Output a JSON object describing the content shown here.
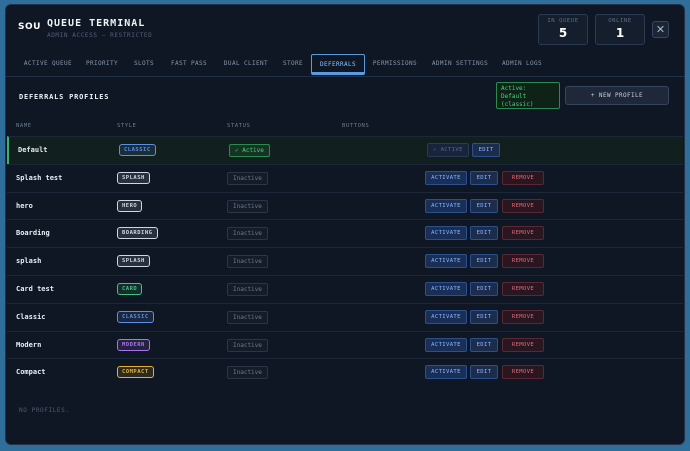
{
  "app": {
    "logo": "SOU",
    "title": "QUEUE TERMINAL",
    "subtitle": "ADMIN ACCESS — RESTRICTED",
    "close_label": "✕"
  },
  "stats": {
    "in_queue_label": "IN QUEUE",
    "in_queue_value": "5",
    "online_label": "ONLINE",
    "online_value": "1"
  },
  "tabs": [
    "ACTIVE QUEUE",
    "PRIORITY",
    "SLOTS",
    "FAST PASS",
    "DUAL CLIENT",
    "STORE",
    "DEFERRALS",
    "PERMISSIONS",
    "ADMIN SETTINGS",
    "ADMIN LOGS"
  ],
  "active_tab": "DEFERRALS",
  "section": {
    "title": "DEFERRALS PROFILES",
    "active_line1": "Active:",
    "active_line2": "Default",
    "active_line3": "(classic)",
    "new_profile": "+ NEW PROFILE"
  },
  "columns": {
    "name": "NAME",
    "style": "STYLE",
    "status": "STATUS",
    "buttons": "BUTTONS"
  },
  "actions": {
    "activate": "ACTIVATE",
    "active": "✓ ACTIVE",
    "edit": "EDIT",
    "remove": "REMOVE"
  },
  "status_text": {
    "active": "✓ Active",
    "inactive": "Inactive"
  },
  "style_colors": {
    "classic": "#5a8fe8",
    "splash": "#cfd6df",
    "hero": "#cfd6df",
    "boarding": "#cfd6df",
    "card": "#3fc47a",
    "modern": "#a874f0",
    "compact": "#e6b030"
  },
  "profiles": [
    {
      "name": "Default",
      "style": "CLASSIC",
      "style_key": "classic",
      "active": true
    },
    {
      "name": "Splash test",
      "style": "SPLASH",
      "style_key": "splash",
      "active": false
    },
    {
      "name": "hero",
      "style": "HERO",
      "style_key": "hero",
      "active": false
    },
    {
      "name": "Boarding",
      "style": "BOARDING",
      "style_key": "boarding",
      "active": false
    },
    {
      "name": "splash",
      "style": "SPLASH",
      "style_key": "splash",
      "active": false
    },
    {
      "name": "Card test",
      "style": "CARD",
      "style_key": "card",
      "active": false
    },
    {
      "name": "Classic",
      "style": "CLASSIC",
      "style_key": "classic",
      "active": false
    },
    {
      "name": "Modern",
      "style": "MODERN",
      "style_key": "modern",
      "active": false
    },
    {
      "name": "Compact",
      "style": "COMPACT",
      "style_key": "compact",
      "active": false
    }
  ],
  "empty_text": "NO PROFILES."
}
